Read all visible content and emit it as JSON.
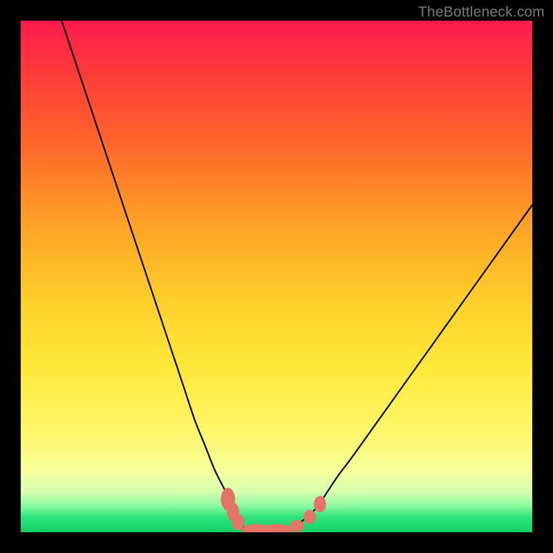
{
  "watermark": {
    "text": "TheBottleneck.com"
  },
  "colors": {
    "curve_stroke": "#000000",
    "marker_fill": "#e57368",
    "marker_stroke": "#e57368"
  },
  "chart_data": {
    "type": "line",
    "title": "",
    "xlabel": "",
    "ylabel": "",
    "xlim": [
      0,
      100
    ],
    "ylim": [
      0,
      100
    ],
    "grid": false,
    "legend": false,
    "series": [
      {
        "name": "bottleneck-curve",
        "x": [
          8,
          10,
          12,
          14,
          16,
          18,
          20,
          22,
          24,
          26,
          28,
          30,
          32,
          34,
          36,
          38,
          40,
          41,
          42,
          43,
          44,
          46,
          48,
          50,
          52,
          54,
          56,
          58,
          60,
          62,
          65,
          70,
          75,
          80,
          85,
          90,
          95,
          100
        ],
        "y": [
          100,
          94,
          88,
          82,
          76,
          70,
          64,
          58,
          52,
          46,
          40,
          34,
          28,
          22,
          17,
          12,
          8,
          5,
          3,
          1.5,
          0.8,
          0.4,
          0.4,
          0.4,
          0.6,
          1.5,
          3,
          5,
          8,
          11,
          15,
          22,
          29,
          36,
          43,
          50,
          57,
          64
        ]
      }
    ],
    "markers": [
      {
        "x": 40.5,
        "y": 6.5,
        "rx": 1.4,
        "ry": 2.2
      },
      {
        "x": 41.5,
        "y": 4.0,
        "rx": 1.2,
        "ry": 1.8
      },
      {
        "x": 42.5,
        "y": 2.0,
        "rx": 1.2,
        "ry": 1.6
      },
      {
        "x": 46.0,
        "y": 0.5,
        "rx": 2.8,
        "ry": 1.1
      },
      {
        "x": 50.0,
        "y": 0.5,
        "rx": 3.0,
        "ry": 1.1
      },
      {
        "x": 54.0,
        "y": 1.2,
        "rx": 1.4,
        "ry": 1.2
      },
      {
        "x": 56.5,
        "y": 3.0,
        "rx": 1.2,
        "ry": 1.4
      },
      {
        "x": 58.5,
        "y": 5.5,
        "rx": 1.2,
        "ry": 1.6
      }
    ]
  }
}
